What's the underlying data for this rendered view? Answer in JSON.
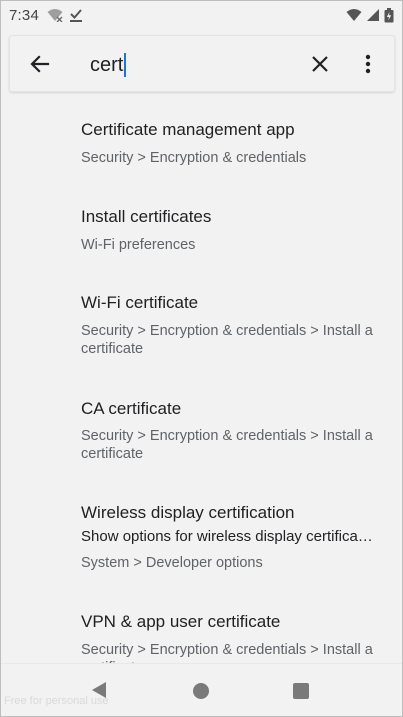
{
  "status_bar": {
    "time": "7:34",
    "left_icons": [
      "wifi-off-icon",
      "download-done-icon"
    ],
    "right_icons": [
      "wifi-icon",
      "cell-signal-icon",
      "battery-icon"
    ]
  },
  "search": {
    "query": "cert"
  },
  "results": [
    {
      "title": "Certificate management app",
      "path": "Security > Encryption & credentials"
    },
    {
      "title": "Install certificates",
      "path": "Wi-Fi preferences"
    },
    {
      "title": "Wi-Fi certificate",
      "path": "Security > Encryption & credentials > Install a certificate"
    },
    {
      "title": "CA certificate",
      "path": "Security > Encryption & credentials > Install a certificate"
    },
    {
      "title": "Wireless display certification",
      "summary": "Show options for wireless display certifica…",
      "path": "System > Developer options"
    },
    {
      "title": "VPN & app user certificate",
      "path": "Security > Encryption & credentials > Install a certificate"
    }
  ],
  "watermark": "Free for personal use",
  "colors": {
    "background": "#f2f2f2",
    "accent_caret": "#1a73e8",
    "secondary_text": "#5f6368"
  }
}
